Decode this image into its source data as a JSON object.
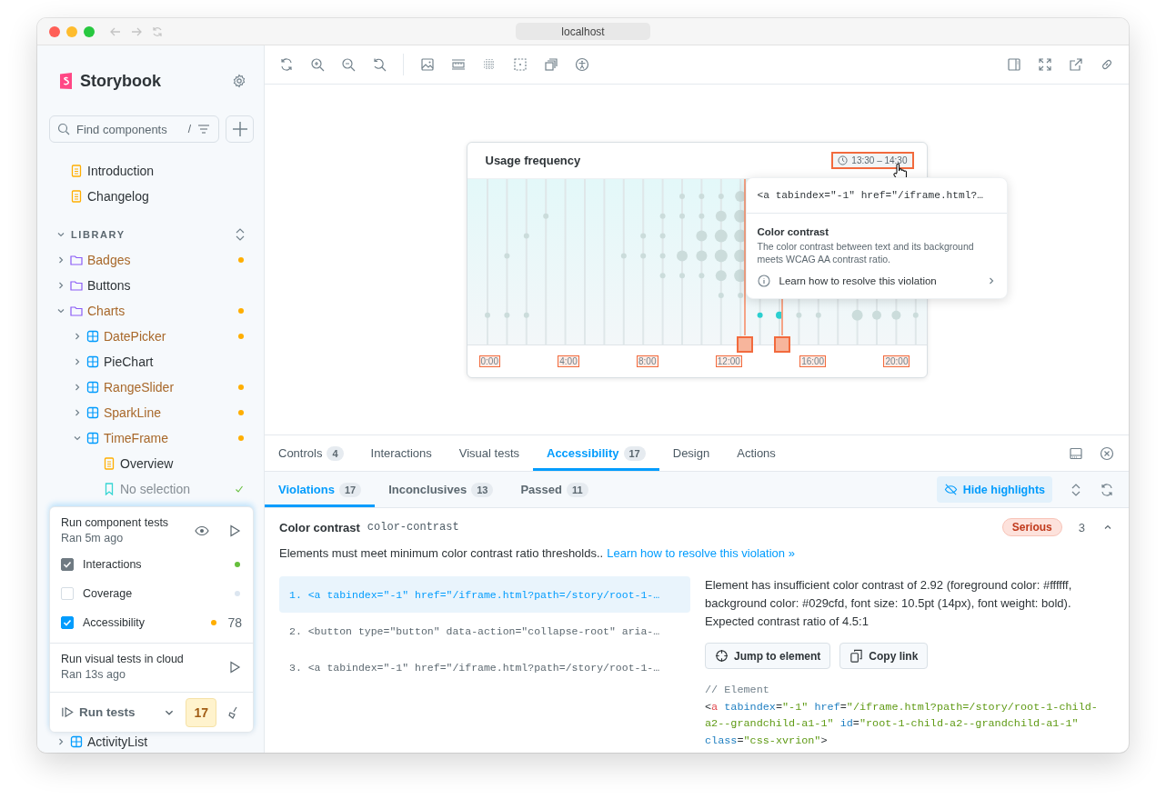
{
  "browser": {
    "url": "localhost"
  },
  "sidebar": {
    "brand": "Storybook",
    "search": {
      "placeholder": "Find components",
      "shortcut": "/"
    },
    "docs": [
      {
        "label": "Introduction",
        "kind": "doc"
      },
      {
        "label": "Changelog",
        "kind": "doc"
      }
    ],
    "library": {
      "title": "LIBRARY",
      "expanded": true,
      "items": [
        {
          "label": "Badges",
          "kind": "folder",
          "expanded": false,
          "warning": true,
          "passed": false
        },
        {
          "label": "Buttons",
          "kind": "folder",
          "expanded": false,
          "warning": false,
          "passed": false
        },
        {
          "label": "Charts",
          "kind": "folder",
          "expanded": true,
          "warning": true,
          "passed": false,
          "children": [
            {
              "label": "DatePicker",
              "kind": "component",
              "expanded": false,
              "warning": true,
              "passed": false
            },
            {
              "label": "PieChart",
              "kind": "component",
              "expanded": false,
              "warning": false,
              "passed": false
            },
            {
              "label": "RangeSlider",
              "kind": "component",
              "expanded": false,
              "warning": true,
              "passed": false
            },
            {
              "label": "SparkLine",
              "kind": "component",
              "expanded": false,
              "warning": true,
              "passed": false
            },
            {
              "label": "TimeFrame",
              "kind": "component",
              "expanded": true,
              "warning": true,
              "passed": false,
              "children": [
                {
                  "label": "Overview",
                  "kind": "doc",
                  "warning": false,
                  "passed": false
                },
                {
                  "label": "No selection",
                  "kind": "story",
                  "warning": false,
                  "passed": true
                }
              ]
            }
          ]
        },
        {
          "label": "ActivityList",
          "kind": "component",
          "expanded": false,
          "warning": false,
          "passed": false
        }
      ]
    }
  },
  "testing": {
    "component_tests": {
      "title": "Run component tests",
      "subtitle": "Ran 5m ago",
      "options": [
        {
          "label": "Interactions",
          "checked": true,
          "disabled": true,
          "color": "#66bf3c"
        },
        {
          "label": "Coverage",
          "checked": false,
          "disabled": false,
          "color": "#dce6f0"
        },
        {
          "label": "Accessibility",
          "checked": true,
          "disabled": false,
          "color": "#ffae00",
          "count": "78"
        }
      ]
    },
    "visual_tests": {
      "title": "Run visual tests in cloud",
      "subtitle": "Ran 13s ago"
    },
    "run_button": "Run tests",
    "badge": "17"
  },
  "preview": {
    "highlights_visible": true,
    "card": {
      "title": "Usage frequency",
      "range": "13:30 – 14:30",
      "x_labels": [
        "0:00",
        "4:00",
        "8:00",
        "12:00",
        "16:00",
        "20:00"
      ]
    },
    "popover": {
      "code": "<a tabindex=\"-1\" href=\"/iframe.html?…",
      "title": "Color contrast",
      "description": "The color contrast between text and its background meets WCAG AA contrast ratio.",
      "link": "Learn how to resolve this violation"
    }
  },
  "addon": {
    "tabs": [
      {
        "label": "Controls",
        "count": "4",
        "selected": false
      },
      {
        "label": "Interactions",
        "selected": false
      },
      {
        "label": "Visual tests",
        "selected": false
      },
      {
        "label": "Accessibility",
        "count": "17",
        "selected": true
      },
      {
        "label": "Design",
        "selected": false
      },
      {
        "label": "Actions",
        "selected": false
      }
    ],
    "subtabs": [
      {
        "label": "Violations",
        "count": "17",
        "selected": true
      },
      {
        "label": "Inconclusives",
        "count": "13",
        "selected": false
      },
      {
        "label": "Passed",
        "count": "11",
        "selected": false
      }
    ],
    "hide_highlights": "Hide highlights",
    "violation": {
      "title": "Color contrast",
      "rule": "color-contrast",
      "severity": {
        "label": "Serious",
        "kind": "serious"
      },
      "count": "3",
      "expanded": true,
      "description": "Elements must meet minimum color contrast ratio thresholds..",
      "link": "Learn how to resolve this violation »"
    },
    "nodes": [
      {
        "number": "1.",
        "code": "<a tabindex=\"-1\" href=\"/iframe.html?path=/story/root-1-…",
        "selected": true
      },
      {
        "number": "2.",
        "code": "<button type=\"button\" data-action=\"collapse-root\" aria-…",
        "selected": false
      },
      {
        "number": "3.",
        "code": "<a tabindex=\"-1\" href=\"/iframe.html?path=/story/root-1-…",
        "selected": false
      }
    ],
    "details": {
      "text": "Element has insufficient color contrast of 2.92 (foreground color: #ffffff, background color: #029cfd, font size: 10.5pt (14px), font weight: bold). Expected contrast ratio of 4.5:1",
      "buttons": [
        {
          "label": "Jump to element",
          "kind": "jump"
        },
        {
          "label": "Copy link",
          "kind": "copy"
        }
      ],
      "comment": "// Element",
      "code_lines": [
        [
          {
            "t": "<",
            "kind": "punct"
          },
          {
            "t": "a",
            "kind": "tag"
          },
          {
            "t": "tabindex",
            "kind": "attr",
            "gap": true
          },
          {
            "t": "=",
            "kind": "punct"
          },
          {
            "t": "\"-1\"",
            "kind": "value"
          },
          {
            "t": "href",
            "kind": "attr",
            "gap": true
          },
          {
            "t": "=",
            "kind": "punct"
          },
          {
            "t": "\"/iframe.html?path=/story/root-1-child-",
            "kind": "value"
          }
        ],
        [
          {
            "t": "a2--grandchild-a1-1\"",
            "kind": "value"
          },
          {
            "t": "id",
            "kind": "attr",
            "gap": true
          },
          {
            "t": "=",
            "kind": "punct"
          },
          {
            "t": "\"root-1-child-a2--grandchild-a1-1\"",
            "kind": "value"
          }
        ],
        [
          {
            "t": "class",
            "kind": "attr"
          },
          {
            "t": "=",
            "kind": "punct"
          },
          {
            "t": "\"css-xvrion\"",
            "kind": "value"
          },
          {
            "t": ">",
            "kind": "punct"
          }
        ]
      ]
    }
  }
}
